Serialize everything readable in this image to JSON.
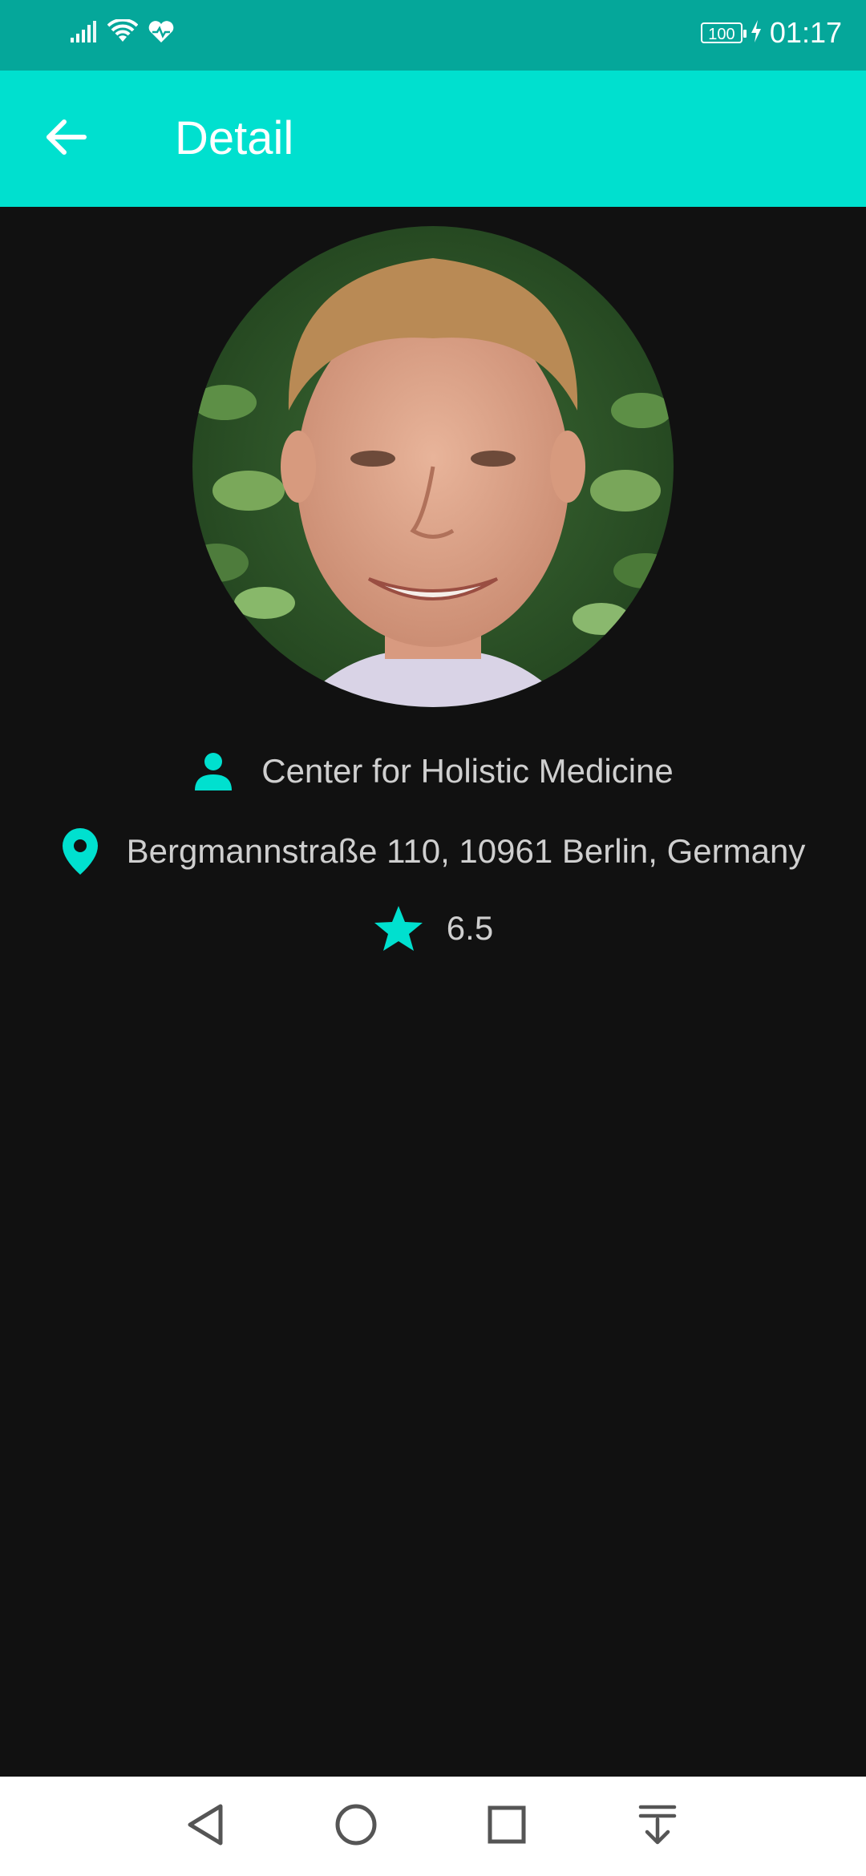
{
  "status_bar": {
    "battery": "100",
    "time": "01:17"
  },
  "app_bar": {
    "title": "Detail",
    "back_icon": "arrow-back-icon"
  },
  "profile": {
    "avatar_icon": "doctor-portrait",
    "name": "Center for Holistic Medicine",
    "address": "Bergmannstraße 110, 10961 Berlin, Germany",
    "rating": "6.5"
  },
  "colors": {
    "accent": "#00E0CF",
    "status_bar": "#05A79A",
    "background": "#111111",
    "text": "#CFCFCF"
  },
  "nav_bar": {
    "icons": [
      "back-triangle-icon",
      "home-circle-icon",
      "recents-square-icon",
      "notification-pulldown-icon"
    ]
  }
}
